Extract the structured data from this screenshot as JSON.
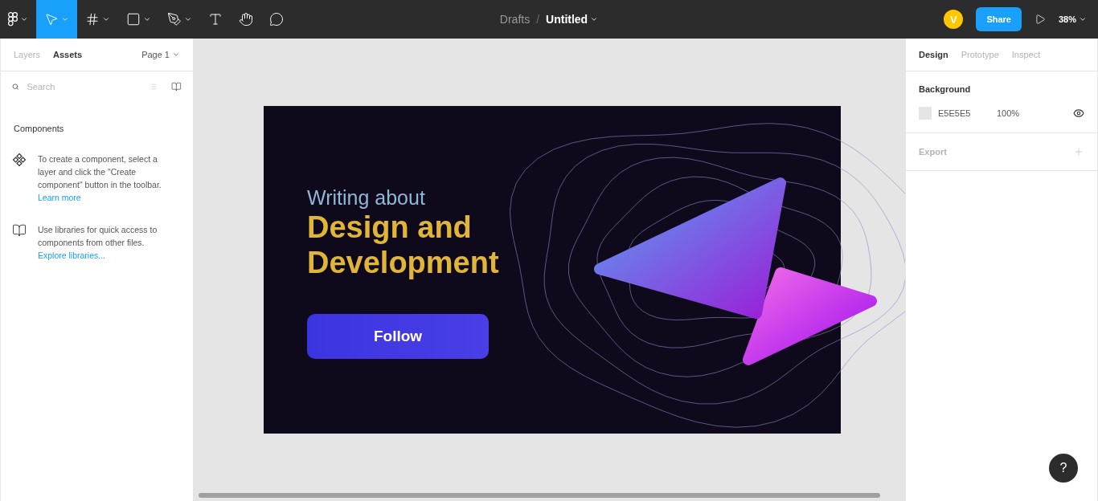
{
  "toolbar": {
    "tools": [
      {
        "kind": "main-menu",
        "selected": false
      },
      {
        "kind": "move",
        "selected": true
      },
      {
        "kind": "frame",
        "selected": false
      },
      {
        "kind": "shape",
        "selected": false
      },
      {
        "kind": "pen",
        "selected": false
      },
      {
        "kind": "text",
        "selected": false
      },
      {
        "kind": "hand",
        "selected": false
      },
      {
        "kind": "comment",
        "selected": false
      }
    ],
    "breadcrumb": {
      "folder": "Drafts",
      "separator": "/",
      "file": "Untitled"
    },
    "avatar": "V",
    "share": "Share",
    "zoom": "38%"
  },
  "left_panel": {
    "tabs": [
      {
        "label": "Layers",
        "selected": false
      },
      {
        "label": "Assets",
        "selected": true
      }
    ],
    "page": "Page 1",
    "search": {
      "placeholder": "Search"
    },
    "section": "Components",
    "hints": [
      {
        "kind": "component",
        "text": "To create a component, select a layer and click the \"Create component\" button in the toolbar.",
        "link": "Learn more"
      },
      {
        "kind": "library",
        "text": "Use libraries for quick access to components from other files.",
        "link": "Explore libraries..."
      }
    ]
  },
  "canvas": {
    "frame": {
      "eyebrow": "Writing about",
      "headline": "Design and Development",
      "button": "Follow"
    }
  },
  "right_panel": {
    "tabs": [
      {
        "label": "Design",
        "selected": true
      },
      {
        "label": "Prototype",
        "selected": false
      },
      {
        "label": "Inspect",
        "selected": false
      }
    ],
    "background": {
      "title": "Background",
      "color": "#e5e5e5",
      "hex": "E5E5E5",
      "opacity": "100%",
      "visible": true
    },
    "export": {
      "title": "Export"
    }
  },
  "help": "?"
}
